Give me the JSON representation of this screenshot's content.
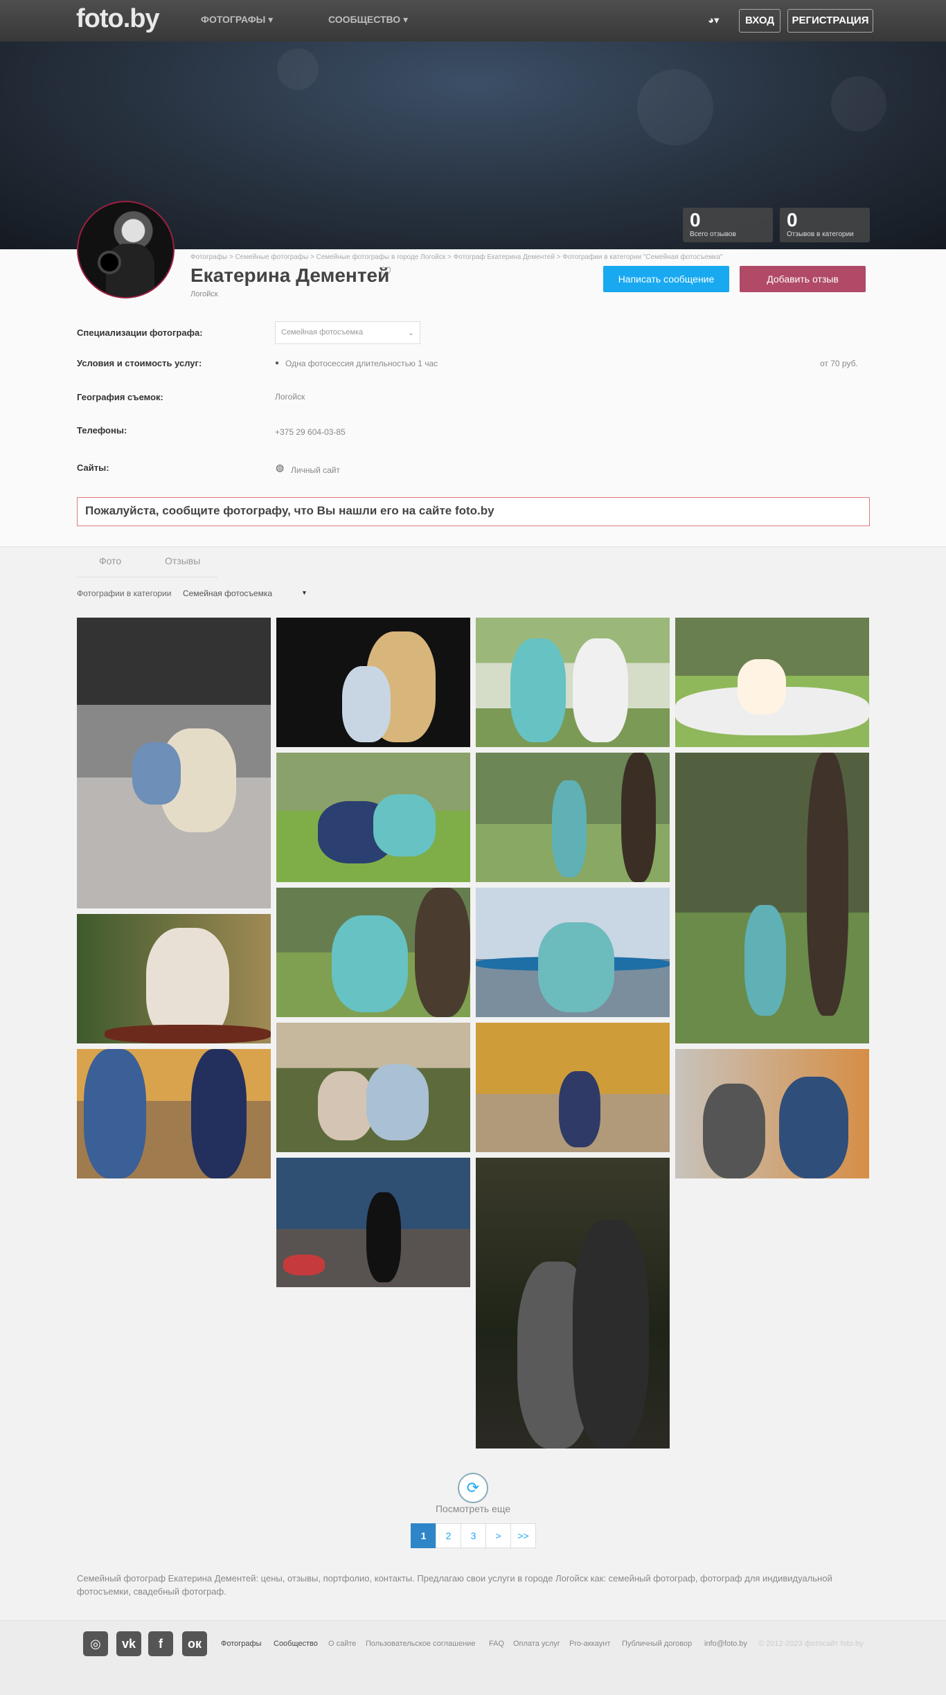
{
  "header": {
    "logo": "foto.by",
    "nav": [
      "ФОТОГРАФЫ ▾",
      "СООБЩЕСТВО ▾"
    ],
    "lang": "◕▾",
    "login": "ВХОД",
    "register": "РЕГИСТРАЦИЯ"
  },
  "stats": [
    {
      "value": "0",
      "label": "Всего отзывов"
    },
    {
      "value": "0",
      "label": "Отзывов в категории"
    }
  ],
  "breadcrumb": "Фотографы > Семейные фотографы > Семейные фотографы в городе Логойск > Фотограф Екатерина Дементей > Фотографии в категории \"Семейная фотосъемка\"",
  "profile": {
    "name": "Екатерина Дементей",
    "city": "Логойск",
    "message_button": "Написать сообщение",
    "review_button": "Добавить отзыв"
  },
  "details": {
    "spec_label": "Специализации фотографа:",
    "spec_value": "Семейная фотосъемка",
    "price_label": "Условия и стоимость услуг:",
    "price_item": "Одна фотосессия длительностью 1 час",
    "price_value": "от 70 руб.",
    "geo_label": "География съемок:",
    "geo_value": "Логойск",
    "phone_label": "Телефоны:",
    "phone_value": "+375 29 604-03-85",
    "site_label": "Сайты:",
    "site_value": "Личный сайт"
  },
  "notice": "Пожалуйста, сообщите фотографу, что Вы нашли его на сайте foto.by",
  "tabs": [
    "Фото",
    "Отзывы"
  ],
  "category_label": "Фотографии в категории",
  "category_value": "Семейная фотосъемка",
  "load_more": "Посмотреть еще",
  "pagination": [
    "1",
    "2",
    "3",
    ">",
    ">>"
  ],
  "description": "Семейный фотограф Екатерина Дементей: цены, отзывы, портфолио, контакты. Предлагаю свои услуги в городе Логойск как: семейный фотограф, фотограф для индивидуальной фотосъемки, свадебный фотограф.",
  "footer": {
    "social": [
      "instagram-icon",
      "vk-icon",
      "facebook-icon",
      "odnoklassniki-icon"
    ],
    "links": [
      "Фотографы",
      "Сообщество",
      "О сайте",
      "Пользовательское соглашение",
      "FAQ",
      "Оплата услуг",
      "Pro-аккаунт",
      "Публичный договор",
      "info@foto.by"
    ],
    "copyright": "© 2012-2023 фотосайт foto.by"
  }
}
